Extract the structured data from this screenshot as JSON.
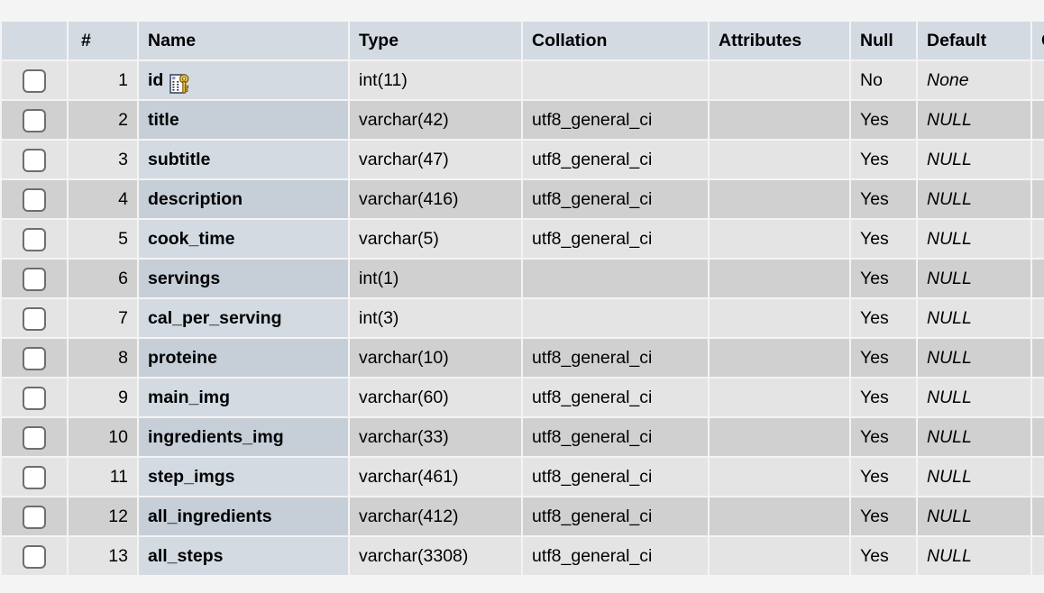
{
  "table": {
    "columns": [
      {
        "key": "check",
        "label": ""
      },
      {
        "key": "num",
        "label": "#"
      },
      {
        "key": "name",
        "label": "Name"
      },
      {
        "key": "type",
        "label": "Type"
      },
      {
        "key": "coll",
        "label": "Collation"
      },
      {
        "key": "attr",
        "label": "Attributes"
      },
      {
        "key": "null",
        "label": "Null"
      },
      {
        "key": "def",
        "label": "Default"
      },
      {
        "key": "comment",
        "label": "C"
      }
    ],
    "headers": {
      "check": "",
      "num": "#",
      "name": "Name",
      "type": "Type",
      "collation": "Collation",
      "attributes": "Attributes",
      "null": "Null",
      "default": "Default",
      "comments_truncated": "C"
    },
    "rows": [
      {
        "num": "1",
        "name": "id",
        "type": "int(11)",
        "collation": "",
        "attributes": "",
        "null": "No",
        "default": "None",
        "primary_key": true
      },
      {
        "num": "2",
        "name": "title",
        "type": "varchar(42)",
        "collation": "utf8_general_ci",
        "attributes": "",
        "null": "Yes",
        "default": "NULL",
        "primary_key": false
      },
      {
        "num": "3",
        "name": "subtitle",
        "type": "varchar(47)",
        "collation": "utf8_general_ci",
        "attributes": "",
        "null": "Yes",
        "default": "NULL",
        "primary_key": false
      },
      {
        "num": "4",
        "name": "description",
        "type": "varchar(416)",
        "collation": "utf8_general_ci",
        "attributes": "",
        "null": "Yes",
        "default": "NULL",
        "primary_key": false
      },
      {
        "num": "5",
        "name": "cook_time",
        "type": "varchar(5)",
        "collation": "utf8_general_ci",
        "attributes": "",
        "null": "Yes",
        "default": "NULL",
        "primary_key": false
      },
      {
        "num": "6",
        "name": "servings",
        "type": "int(1)",
        "collation": "",
        "attributes": "",
        "null": "Yes",
        "default": "NULL",
        "primary_key": false
      },
      {
        "num": "7",
        "name": "cal_per_serving",
        "type": "int(3)",
        "collation": "",
        "attributes": "",
        "null": "Yes",
        "default": "NULL",
        "primary_key": false
      },
      {
        "num": "8",
        "name": "proteine",
        "type": "varchar(10)",
        "collation": "utf8_general_ci",
        "attributes": "",
        "null": "Yes",
        "default": "NULL",
        "primary_key": false
      },
      {
        "num": "9",
        "name": "main_img",
        "type": "varchar(60)",
        "collation": "utf8_general_ci",
        "attributes": "",
        "null": "Yes",
        "default": "NULL",
        "primary_key": false
      },
      {
        "num": "10",
        "name": "ingredients_img",
        "type": "varchar(33)",
        "collation": "utf8_general_ci",
        "attributes": "",
        "null": "Yes",
        "default": "NULL",
        "primary_key": false
      },
      {
        "num": "11",
        "name": "step_imgs",
        "type": "varchar(461)",
        "collation": "utf8_general_ci",
        "attributes": "",
        "null": "Yes",
        "default": "NULL",
        "primary_key": false
      },
      {
        "num": "12",
        "name": "all_ingredients",
        "type": "varchar(412)",
        "collation": "utf8_general_ci",
        "attributes": "",
        "null": "Yes",
        "default": "NULL",
        "primary_key": false
      },
      {
        "num": "13",
        "name": "all_steps",
        "type": "varchar(3308)",
        "collation": "utf8_general_ci",
        "attributes": "",
        "null": "Yes",
        "default": "NULL",
        "primary_key": false
      }
    ],
    "icons": {
      "primary_key": "primary-key-icon",
      "row_select": "row-checkbox"
    },
    "colors": {
      "page_background": "#f4f4f4",
      "header_background": "#d3dae2",
      "row_odd": "#e4e4e4",
      "row_even": "#d0d0d0",
      "name_cell_odd": "#d3dae2",
      "name_cell_even": "#c6ced8",
      "key_icon_gold": "#f2c94c",
      "text": "#000000"
    }
  }
}
